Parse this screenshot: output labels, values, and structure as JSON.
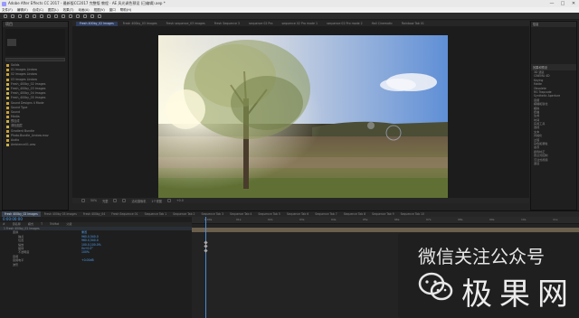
{
  "window": {
    "title": "Adobe After Effects CC 2017 - 最新版CC2017 完整版 教程 · AE 风光调色预设 (已编辑).aep *",
    "controls": [
      "—",
      "□",
      "✕"
    ]
  },
  "menu": [
    "文件(F)",
    "编辑(E)",
    "合成(C)",
    "图层(L)",
    "效果(T)",
    "动画(A)",
    "视图(V)",
    "窗口",
    "帮助(H)"
  ],
  "project": {
    "header": "项目",
    "items": [
      {
        "label": "Solids",
        "type": "folder"
      },
      {
        "label": "01 Images Lindow",
        "type": "folder"
      },
      {
        "label": "02 Images Lindow",
        "type": "folder"
      },
      {
        "label": "03 Images Lindow",
        "type": "folder"
      },
      {
        "label": "Fresh_400by_02 Images",
        "type": "item"
      },
      {
        "label": "Fresh_400by_03 Images",
        "type": "item"
      },
      {
        "label": "Fresh_400by_04 Images",
        "type": "item"
      },
      {
        "label": "Fresh_400by_05 Images",
        "type": "item"
      },
      {
        "label": "Sound Designs 4 Mode",
        "type": "folder"
      },
      {
        "label": "Sound Type",
        "type": "folder"
      },
      {
        "label": "Sound",
        "type": "folder"
      },
      {
        "label": "Media",
        "type": "folder"
      },
      {
        "label": "预合成",
        "type": "item"
      },
      {
        "label": "调色图层",
        "type": "item"
      },
      {
        "label": "Gradient Bundle",
        "type": "folder"
      },
      {
        "label": "Photo.Bundle_Lindow.mov",
        "type": "item"
      },
      {
        "label": "Audio",
        "type": "folder"
      },
      {
        "label": "Ambience01.wav",
        "type": "item"
      }
    ]
  },
  "viewer": {
    "tabs": [
      "Fresh 400by_02 Images",
      "Fresh 400by_03 Images",
      "Fresh sequence_03 images",
      "Fresh Sequence 3",
      "sequence 02 Pro",
      "sequence 02 Pro mode 1",
      "sequence 02 Pro mode 2",
      "Hall Cinematic",
      "Rainbow Tab 01"
    ],
    "active_tab": 0,
    "controls": [
      "50%",
      "完整",
      "活动摄像机",
      "1个视图",
      "+0.0"
    ]
  },
  "effects": {
    "header1": "信息",
    "header2": "效果和预设",
    "items": [
      "3D 通道",
      "CINEMA 4D",
      "Keying",
      "Matte",
      "Obsolete",
      "RG Trapcode",
      "Synthetic Aperture",
      "音频",
      "模糊和锐化",
      "模拟",
      "扭曲",
      "生成",
      "时间",
      "实用工具",
      "透视",
      "文本",
      "风格化",
      "过渡",
      "杂色和颗粒",
      "遮罩",
      "颜色校正",
      "表达式控制",
      "沉浸式视频",
      "通道"
    ]
  },
  "comp_tabs": [
    "Fresh 400by_02 Images",
    "Fresh 400by 03 Images",
    "Fresh 400by_04",
    "Fresh Sequence 01",
    "Sequence Tab 1",
    "Sequence Tab 2",
    "Sequence Tab 3",
    "Sequence Tab 4",
    "Sequence Tab 5",
    "Sequence Tab 6",
    "Sequence Tab 7",
    "Sequence Tab 8",
    "Sequence Tab 9",
    "Sequence Tab 10"
  ],
  "timeline": {
    "timecode": "0:00:00:00",
    "columns": [
      "#",
      "源名称",
      "模式",
      "T",
      "TrkMat",
      "父级"
    ],
    "rows": [
      {
        "name": "1  Fresh 400by_02 Images",
        "value": "",
        "layer": true
      },
      {
        "name": "变换",
        "value": "重置"
      },
      {
        "name": "锚点",
        "value": "960.0,540.0"
      },
      {
        "name": "位置",
        "value": "960.0,540.0"
      },
      {
        "name": "缩放",
        "value": "100.0,100.0%"
      },
      {
        "name": "旋转",
        "value": "0x+0.0°"
      },
      {
        "name": "不透明度",
        "value": "100%"
      },
      {
        "name": "音频",
        "value": ""
      },
      {
        "name": "音频电平",
        "value": "+0.00dB"
      },
      {
        "name": "波形",
        "value": ""
      }
    ],
    "ruler": [
      "0:00s",
      "01s",
      "02s",
      "03s",
      "04s",
      "05s",
      "06s",
      "07s",
      "08s",
      "09s",
      "10s",
      "11s"
    ]
  },
  "watermark": {
    "title": "微信关注公众号",
    "brand": "极果网"
  }
}
